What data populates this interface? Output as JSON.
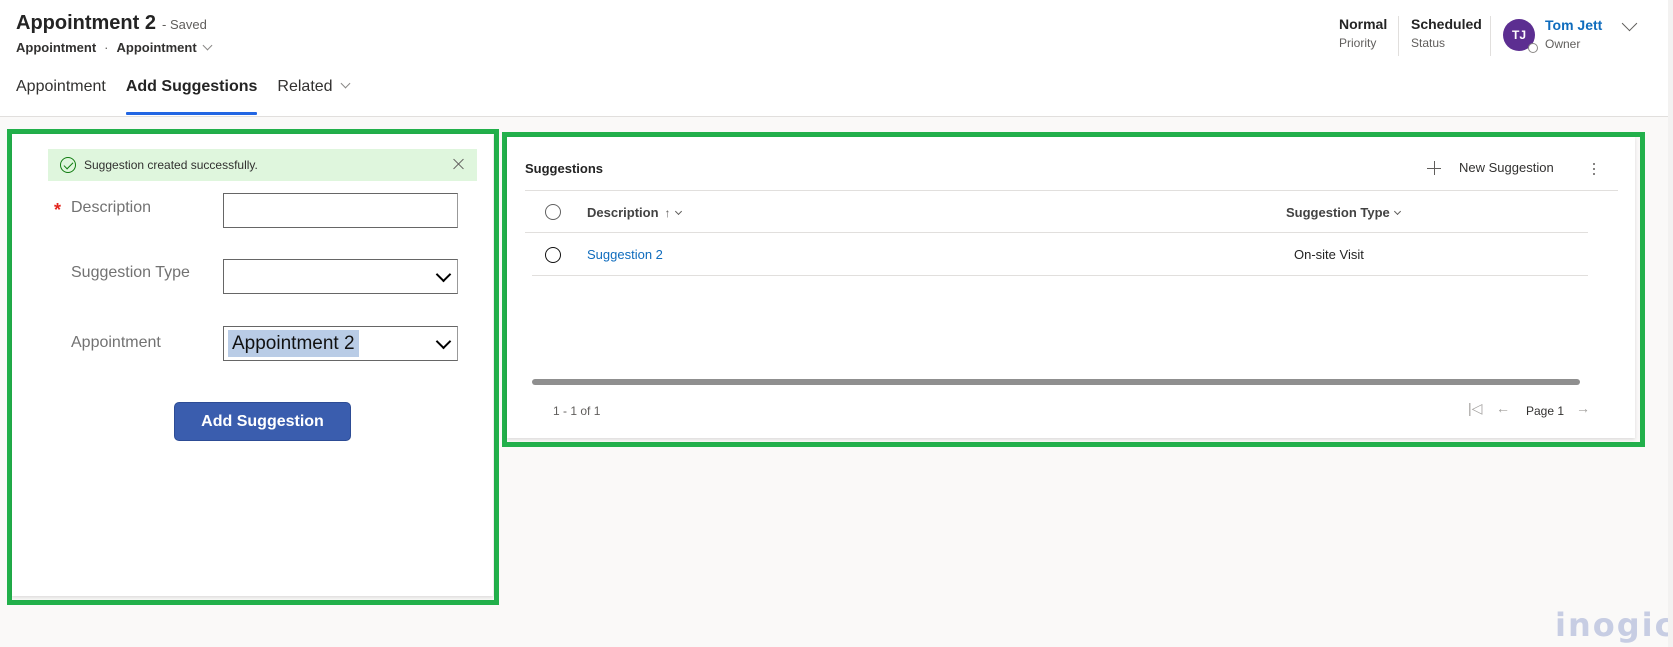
{
  "header": {
    "title": "Appointment 2",
    "saved_status": "- Saved",
    "entity_type": "Appointment",
    "separator": "·",
    "form_selector": "Appointment",
    "fields": [
      {
        "value": "Normal",
        "label": "Priority"
      },
      {
        "value": "Scheduled",
        "label": "Status"
      }
    ],
    "owner": {
      "initials": "TJ",
      "name": "Tom Jett",
      "label": "Owner",
      "avatar_color": "#5c2e91"
    }
  },
  "tabs": [
    {
      "label": "Appointment",
      "active": false
    },
    {
      "label": "Add Suggestions",
      "active": true
    },
    {
      "label": "Related",
      "active": false
    }
  ],
  "form": {
    "notification": "Suggestion created successfully.",
    "fields": [
      {
        "label": "Description",
        "required": "*",
        "value": ""
      },
      {
        "label": "Suggestion Type",
        "value": ""
      },
      {
        "label": "Appointment",
        "value": "Appointment 2"
      }
    ],
    "submit_label": "Add Suggestion"
  },
  "subgrid": {
    "title": "Suggestions",
    "new_label": "New Suggestion",
    "columns": [
      {
        "label": "Description",
        "sort": "↑"
      },
      {
        "label": "Suggestion Type"
      }
    ],
    "rows": [
      {
        "description": "Suggestion 2",
        "type": "On-site Visit"
      }
    ],
    "record_count": "1 - 1 of 1",
    "page_label": "Page 1"
  },
  "watermark": "inogic",
  "colors": {
    "accent": "#2266e3",
    "highlight_frame": "#22b04b",
    "button": "#3a5dae",
    "link": "#0f6cbd"
  }
}
